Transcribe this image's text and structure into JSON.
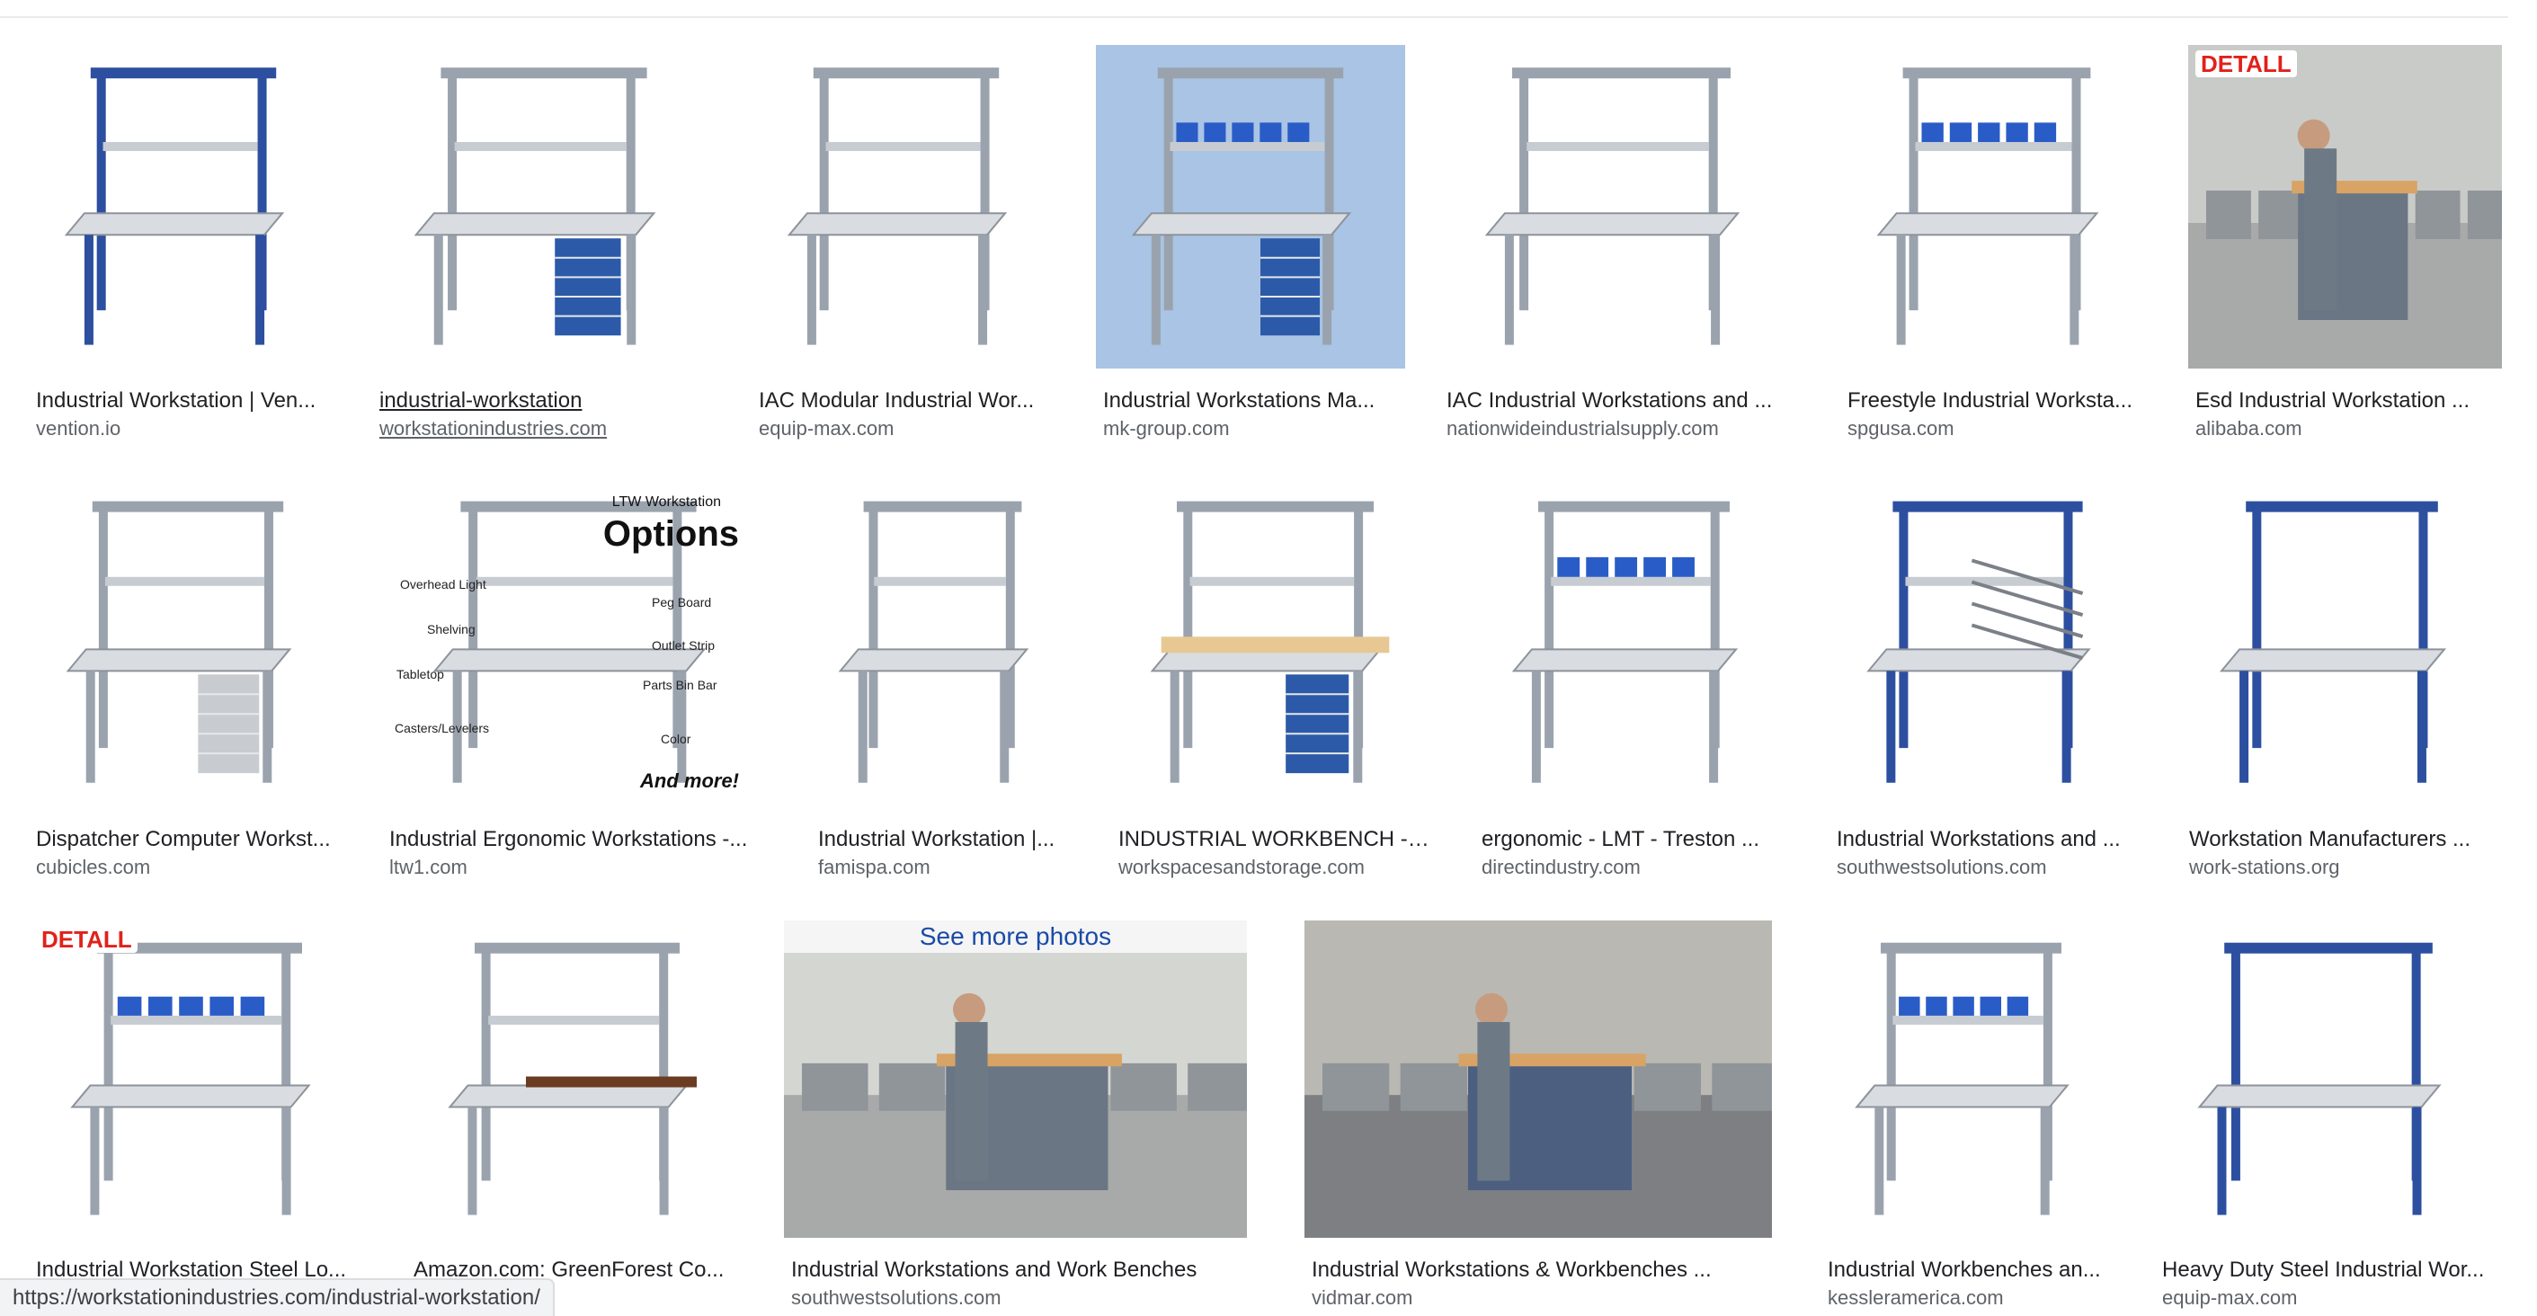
{
  "rows": [
    [
      {
        "title": "Industrial Workstation | Ven...",
        "source": "vention.io",
        "scene": "frame-blue",
        "logo": "",
        "overlay": ""
      },
      {
        "title": "industrial-workstation",
        "source": "workstationindustries.com",
        "scene": "desk-blue",
        "logo": "",
        "overlay": ""
      },
      {
        "title": "IAC Modular Industrial Wor...",
        "source": "equip-max.com",
        "scene": "shelf-white",
        "logo": "",
        "overlay": ""
      },
      {
        "title": "Industrial Workstations Ma...",
        "source": "mk-group.com",
        "scene": "bench-bluebg",
        "logo": "",
        "overlay": ""
      },
      {
        "title": "IAC Industrial Workstations and ...",
        "source": "nationwideindustrialsupply.com",
        "scene": "diagram",
        "logo": "",
        "overlay": ""
      },
      {
        "title": "Freestyle Industrial Worksta...",
        "source": "spgusa.com",
        "scene": "bins-bench",
        "logo": "",
        "overlay": ""
      },
      {
        "title": "Esd Industrial Workstation ...",
        "source": "alibaba.com",
        "scene": "esd-photo",
        "logo": "DETALL",
        "overlay": ""
      }
    ],
    [
      {
        "title": "Dispatcher Computer Workst...",
        "source": "cubicles.com",
        "scene": "cubicle",
        "logo": "",
        "overlay": ""
      },
      {
        "title": "Industrial Ergonomic Workstations -...",
        "source": "ltw1.com",
        "scene": "ltw-options",
        "logo": "",
        "overlay": ""
      },
      {
        "title": "Industrial Workstation |...",
        "source": "famispa.com",
        "scene": "famis",
        "logo": "",
        "overlay": ""
      },
      {
        "title": "INDUSTRIAL WORKBENCH - 8...",
        "source": "workspacesandstorage.com",
        "scene": "workbench-drawers",
        "logo": "",
        "overlay": ""
      },
      {
        "title": "ergonomic - LMT - Treston ...",
        "source": "directindustry.com",
        "scene": "treston",
        "logo": "",
        "overlay": ""
      },
      {
        "title": "Industrial Workstations and ...",
        "source": "southwestsolutions.com",
        "scene": "flow-rack",
        "logo": "",
        "overlay": ""
      },
      {
        "title": "Workstation Manufacturers ...",
        "source": "work-stations.org",
        "scene": "bare-frame",
        "logo": "",
        "overlay": ""
      }
    ],
    [
      {
        "title": "Industrial Workstation Steel Lo...",
        "source": "",
        "scene": "detall-desk",
        "logo": "DETALL",
        "overlay": ""
      },
      {
        "title": "Amazon.com: GreenForest Co...",
        "source": "",
        "scene": "greenforest",
        "logo": "",
        "overlay": ""
      },
      {
        "title": "Industrial Workstations and Work Benches",
        "source": "southwestsolutions.com",
        "scene": "factory-floor",
        "logo": "",
        "overlay": "See more photos"
      },
      {
        "title": "Industrial Workstations & Workbenches ...",
        "source": "vidmar.com",
        "scene": "vidmar",
        "logo": "",
        "overlay": ""
      },
      {
        "title": "Industrial Workbenches an...",
        "source": "kessleramerica.com",
        "scene": "kessler",
        "logo": "",
        "overlay": ""
      },
      {
        "title": "Heavy Duty Steel Industrial Wor...",
        "source": "equip-max.com",
        "scene": "heavy-frame",
        "logo": "",
        "overlay": ""
      }
    ]
  ],
  "ltw": {
    "small_label": "LTW Workstation",
    "title": "Options",
    "more": "And more!",
    "labels": [
      "Overhead Light",
      "Shelving",
      "Tabletop",
      "Casters/Levelers",
      "Peg Board",
      "Outlet Strip",
      "Parts Bin Bar",
      "Color"
    ]
  },
  "status_bar": {
    "url": "https://workstationindustries.com/industrial-workstation/"
  }
}
